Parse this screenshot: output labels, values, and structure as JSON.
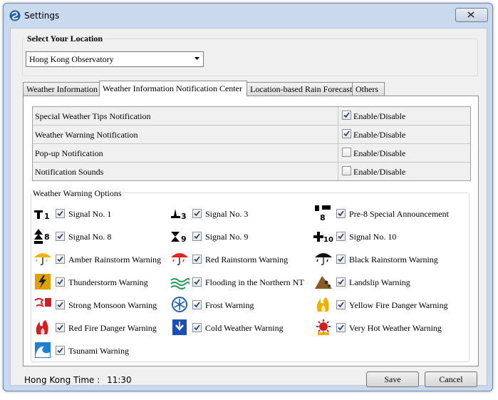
{
  "window": {
    "title": "Settings"
  },
  "location": {
    "group_title": "Select Your Location",
    "selected": "Hong Kong Observatory"
  },
  "tabs": [
    {
      "label": "Weather Information",
      "active": false
    },
    {
      "label": "Weather Information Notification Center",
      "active": true
    },
    {
      "label": "Location-based Rain Forecast",
      "active": false
    },
    {
      "label": "Others",
      "active": false
    }
  ],
  "notifications": [
    {
      "label": "Special Weather Tips Notification",
      "checked": true,
      "option": "Enable/Disable"
    },
    {
      "label": "Weather Warning Notification",
      "checked": true,
      "option": "Enable/Disable"
    },
    {
      "label": "Pop-up Notification",
      "checked": false,
      "option": "Enable/Disable"
    },
    {
      "label": "Notification Sounds",
      "checked": false,
      "option": "Enable/Disable"
    }
  ],
  "warnings": {
    "group_title": "Weather Warning Options",
    "items": [
      {
        "label": "Signal No. 1",
        "checked": true,
        "icon": "signal-1-icon",
        "icon_text": "1"
      },
      {
        "label": "Signal No. 3",
        "checked": true,
        "icon": "signal-3-icon",
        "icon_text": "3"
      },
      {
        "label": "Pre-8 Special Announcement",
        "checked": true,
        "icon": "pre-8-icon",
        "icon_text": "8"
      },
      {
        "label": "Signal No. 8",
        "checked": true,
        "icon": "signal-8-icon",
        "icon_text": "8"
      },
      {
        "label": "Signal No. 9",
        "checked": true,
        "icon": "signal-9-icon",
        "icon_text": "9"
      },
      {
        "label": "Signal No. 10",
        "checked": true,
        "icon": "signal-10-icon",
        "icon_text": "10"
      },
      {
        "label": "Amber Rainstorm Warning",
        "checked": true,
        "icon": "amber-rainstorm-icon",
        "color": "#f5b400"
      },
      {
        "label": "Red Rainstorm Warning",
        "checked": true,
        "icon": "red-rainstorm-icon",
        "color": "#e2231a"
      },
      {
        "label": "Black Rainstorm Warning",
        "checked": true,
        "icon": "black-rainstorm-icon",
        "color": "#111111"
      },
      {
        "label": "Thunderstorm Warning",
        "checked": true,
        "icon": "thunderstorm-icon",
        "color": "#e0a000"
      },
      {
        "label": "Flooding in the Northern NT",
        "checked": true,
        "icon": "flooding-icon",
        "color": "#2a9a5a"
      },
      {
        "label": "Landslip Warning",
        "checked": true,
        "icon": "landslip-icon",
        "color": "#8a5a20"
      },
      {
        "label": "Strong Monsoon Warning",
        "checked": true,
        "icon": "monsoon-icon",
        "color": "#d02020"
      },
      {
        "label": "Frost Warning",
        "checked": true,
        "icon": "frost-icon",
        "color": "#2060b0"
      },
      {
        "label": "Yellow Fire Danger Warning",
        "checked": true,
        "icon": "yellow-fire-icon",
        "color": "#f0b000"
      },
      {
        "label": "Red Fire Danger Warning",
        "checked": true,
        "icon": "red-fire-icon",
        "color": "#d02020"
      },
      {
        "label": "Cold Weather Warning",
        "checked": true,
        "icon": "cold-weather-icon",
        "color": "#1a4fb5"
      },
      {
        "label": "Very Hot Weather Warning",
        "checked": true,
        "icon": "very-hot-icon",
        "color": "#d02020"
      },
      {
        "label": "Tsunami Warning",
        "checked": true,
        "icon": "tsunami-icon",
        "color": "#2080d0"
      }
    ]
  },
  "status": {
    "time_label": "Hong Kong Time :",
    "time_value": "11:30"
  },
  "buttons": {
    "save": "Save",
    "cancel": "Cancel"
  }
}
